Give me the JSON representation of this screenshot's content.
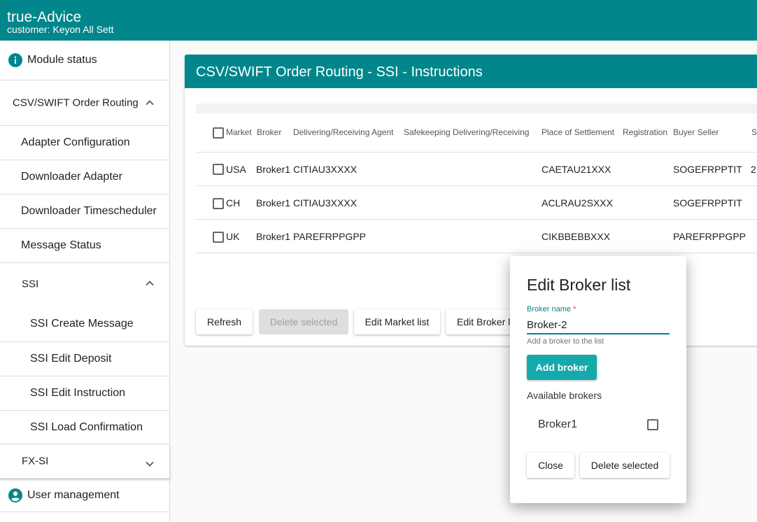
{
  "app": {
    "title": "true-Advice",
    "customer": "customer: Keyon All Sett"
  },
  "sidebar": {
    "module_status": "Module status",
    "order_routing": "CSV/SWIFT Order Routing",
    "adapter_config": "Adapter Configuration",
    "downloader_adapter": "Downloader Adapter",
    "downloader_timescheduler": "Downloader Timescheduler",
    "message_status": "Message Status",
    "ssi": "SSI",
    "ssi_create_message": "SSI Create Message",
    "ssi_edit_deposit": "SSI Edit Deposit",
    "ssi_edit_instruction": "SSI Edit Instruction",
    "ssi_load_confirmation": "SSI Load Confirmation",
    "fx_si": "FX-SI",
    "user_management": "User management"
  },
  "main": {
    "title": "CSV/SWIFT Order Routing - SSI - Instructions",
    "columns": {
      "market": "Market",
      "broker": "Broker",
      "delivering_agent": "Delivering/Receiving Agent",
      "safekeeping": "Safekeeping Delivering/Receiving",
      "place_of_settlement": "Place of Settlement",
      "registration": "Registration",
      "buyer_seller": "Buyer Seller",
      "next": "S"
    },
    "rows": [
      {
        "market": "USA",
        "broker": "Broker1",
        "agent": "CITIAU3XXXX",
        "place": "CAETAU21XXX",
        "buyer_seller": "SOGEFRPPTIT",
        "extra": "2"
      },
      {
        "market": "CH",
        "broker": "Broker1",
        "agent": "CITIAU3XXXX",
        "place": "ACLRAU2SXXX",
        "buyer_seller": "SOGEFRPPTIT",
        "extra": ""
      },
      {
        "market": "UK",
        "broker": "Broker1",
        "agent": "PAREFRPPGPP",
        "place": "CIKBBEBBXXX",
        "buyer_seller": "PAREFRPPGPP",
        "extra": ""
      }
    ],
    "buttons": {
      "refresh": "Refresh",
      "delete_selected": "Delete selected",
      "edit_market_list": "Edit Market list",
      "edit_broker_list": "Edit Broker list"
    }
  },
  "dialog": {
    "title": "Edit Broker list",
    "field_label": "Broker name",
    "required_mark": "*",
    "field_value": "Broker-2",
    "hint": "Add a broker to the list",
    "add_button": "Add broker",
    "available_label": "Available brokers",
    "brokers": [
      "Broker1"
    ],
    "close_button": "Close",
    "delete_button": "Delete selected"
  },
  "colors": {
    "primary": "#00868b",
    "accent": "#16a9ac",
    "required": "#e53935"
  },
  "icons": {
    "module_status": "info-icon",
    "user_management": "account-circle-icon",
    "expanded": "chevron-up-icon",
    "collapsed": "chevron-down-icon"
  }
}
